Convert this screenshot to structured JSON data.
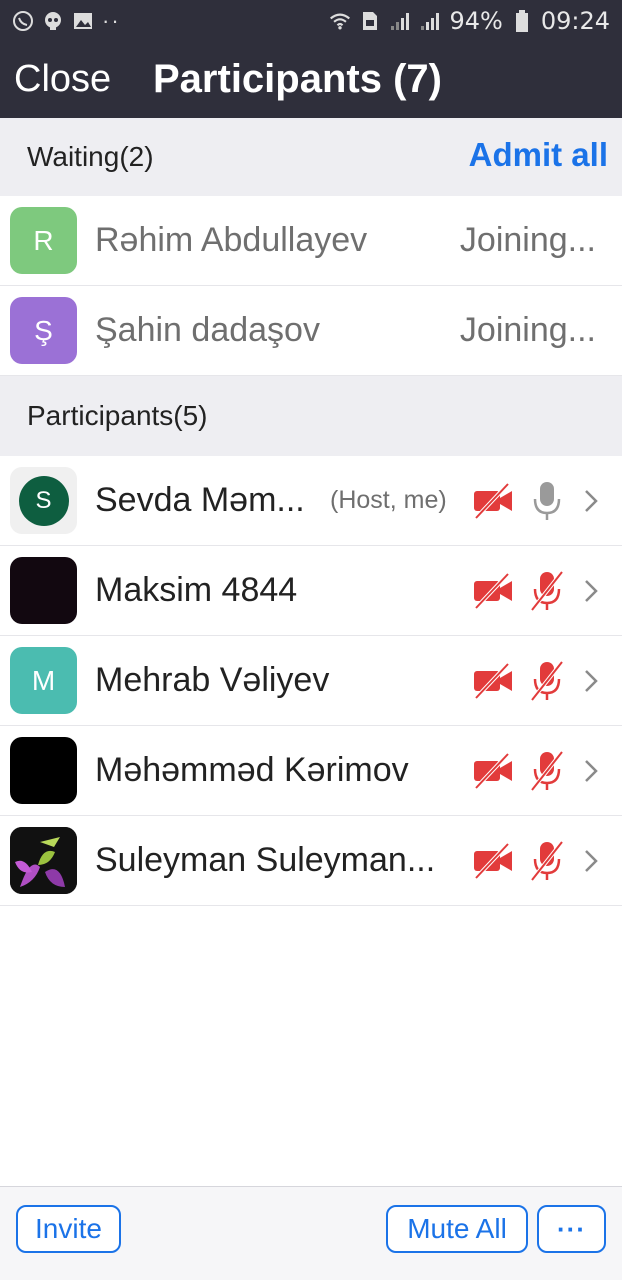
{
  "status_bar": {
    "battery": "94%",
    "time": "09:24",
    "left_icons": [
      "whatsapp-icon",
      "skull-icon",
      "gallery-icon",
      "more-dots-icon"
    ],
    "right_icons": [
      "wifi-icon",
      "sim-icon",
      "signal-1-icon",
      "signal-2-icon",
      "battery-icon"
    ],
    "dots": "··"
  },
  "header": {
    "close_label": "Close",
    "title": "Participants (7)"
  },
  "waiting": {
    "title": "Waiting(2)",
    "admit_all_label": "Admit all",
    "items": [
      {
        "initial": "R",
        "name": "Rəhim Abdullayev",
        "status": "Joining...",
        "avatar_color": "#7ec97e"
      },
      {
        "initial": "Ş",
        "name": "Şahin dadaşov",
        "status": "Joining...",
        "avatar_color": "#9b71d6"
      }
    ]
  },
  "participants": {
    "title": "Participants(5)",
    "items": [
      {
        "initial": "S",
        "name": "Sevda Məm...",
        "tag": "(Host, me)",
        "avatar_type": "initial-ring",
        "avatar_color": "#0e5e40",
        "video": "off",
        "audio": "on"
      },
      {
        "initial": "",
        "name": "Maksim 4844",
        "tag": "",
        "avatar_type": "photo-dark",
        "avatar_color": "#120810",
        "video": "off",
        "audio": "muted"
      },
      {
        "initial": "M",
        "name": "Mehrab Vəliyev",
        "tag": "",
        "avatar_type": "initial",
        "avatar_color": "#4bbcb0",
        "video": "off",
        "audio": "muted"
      },
      {
        "initial": "",
        "name": "Məhəmməd Kərimov",
        "tag": "",
        "avatar_type": "photo-black",
        "avatar_color": "#000000",
        "video": "off",
        "audio": "muted"
      },
      {
        "initial": "",
        "name": "Suleyman Suleyman...",
        "tag": "",
        "avatar_type": "photo-flower",
        "avatar_color": "#111111",
        "video": "off",
        "audio": "muted"
      }
    ]
  },
  "bottom": {
    "invite_label": "Invite",
    "mute_all_label": "Mute All",
    "more_label": "···"
  },
  "colors": {
    "header_bg": "#2f2f3b",
    "accent": "#1b73e8",
    "muted_red": "#e23b3b",
    "section_bg": "#eeeef2"
  }
}
